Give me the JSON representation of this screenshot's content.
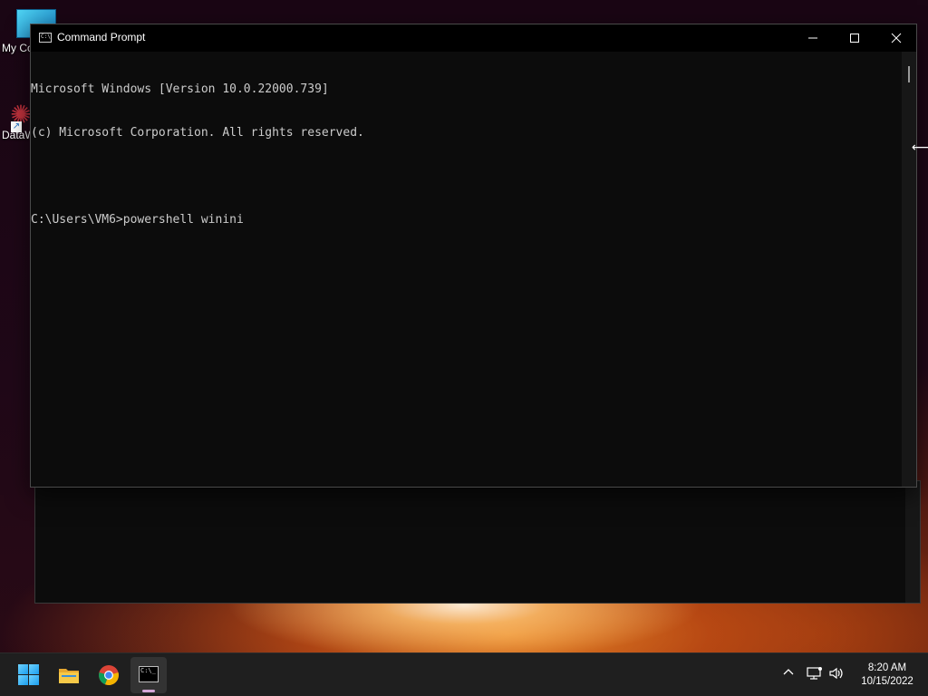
{
  "desktop": {
    "icons": [
      {
        "label": "My Co",
        "icon": "computer-icon"
      },
      {
        "label": "DataW",
        "icon": "shortcut-icon"
      }
    ]
  },
  "window": {
    "title": "Command Prompt",
    "icon": "cmd-icon",
    "controls": {
      "minimize": "minimize-icon",
      "maximize": "maximize-icon",
      "close": "close-icon"
    },
    "console_lines": [
      "Microsoft Windows [Version 10.0.22000.739]",
      "(c) Microsoft Corporation. All rights reserved.",
      "",
      "C:\\Users\\VM6>powershell winini"
    ],
    "colors": {
      "background": "#0c0c0c",
      "text": "#cccccc"
    }
  },
  "taskbar": {
    "apps": [
      {
        "name": "Start",
        "icon": "windows-logo-icon"
      },
      {
        "name": "File Explorer",
        "icon": "folder-icon"
      },
      {
        "name": "Google Chrome",
        "icon": "chrome-icon"
      },
      {
        "name": "Command Prompt",
        "icon": "cmd-icon",
        "active": true
      }
    ],
    "tray": {
      "chevron": "^",
      "network_icon": "network-icon",
      "volume_icon": "volume-icon"
    },
    "clock": {
      "time": "8:20 AM",
      "date": "10/15/2022"
    }
  }
}
